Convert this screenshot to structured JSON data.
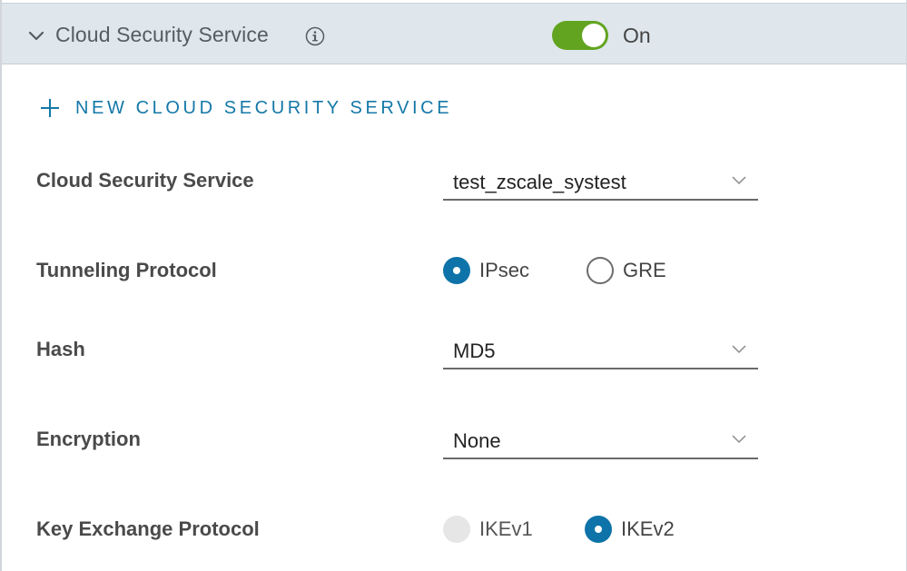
{
  "header": {
    "title": "Cloud Security Service",
    "toggle_state": "On",
    "toggle_on": true
  },
  "actions": {
    "new_service_label": "NEW CLOUD SECURITY SERVICE"
  },
  "form": {
    "cloud_security_service": {
      "label": "Cloud Security Service",
      "value": "test_zscale_systest"
    },
    "tunneling_protocol": {
      "label": "Tunneling Protocol",
      "options": [
        "IPsec",
        "GRE"
      ],
      "selected": "IPsec"
    },
    "hash": {
      "label": "Hash",
      "value": "MD5"
    },
    "encryption": {
      "label": "Encryption",
      "value": "None"
    },
    "key_exchange_protocol": {
      "label": "Key Exchange Protocol",
      "options": [
        "IKEv1",
        "IKEv2"
      ],
      "selected": "IKEv2",
      "disabled": [
        "IKEv1"
      ]
    }
  },
  "colors": {
    "accent": "#0e73a8",
    "toggle_on": "#62a420",
    "header_bg": "#dfe7ed"
  },
  "icons": {
    "collapse": "chevron-down-icon",
    "info": "info-icon",
    "add": "plus-icon",
    "select_caret": "chevron-down-icon"
  }
}
